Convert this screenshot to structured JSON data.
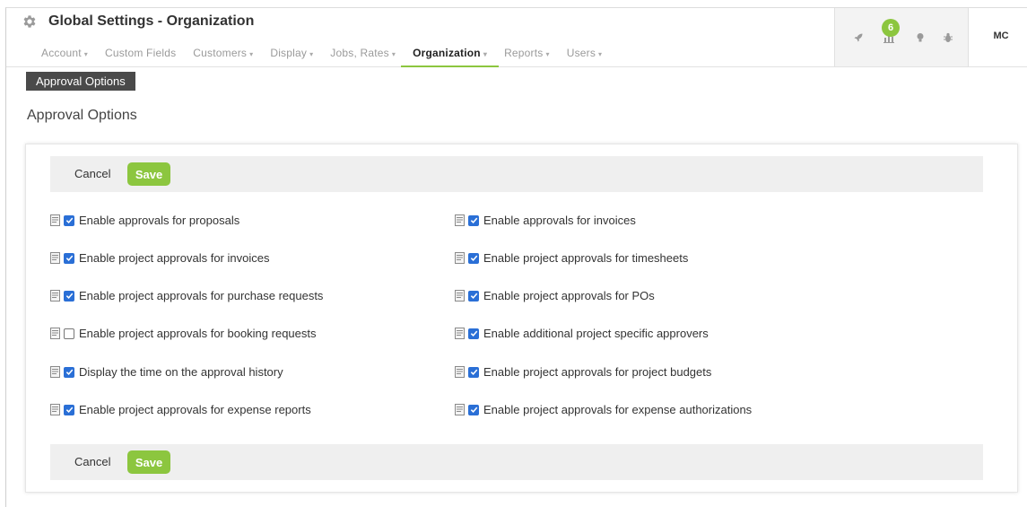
{
  "header": {
    "title": "Global Settings - Organization",
    "icon": "gear-icon",
    "nav": [
      {
        "label": "Account",
        "dropdown": true
      },
      {
        "label": "Custom Fields",
        "dropdown": false
      },
      {
        "label": "Customers",
        "dropdown": true
      },
      {
        "label": "Display",
        "dropdown": true
      },
      {
        "label": "Jobs, Rates",
        "dropdown": true
      },
      {
        "label": "Organization",
        "dropdown": true,
        "active": true
      },
      {
        "label": "Reports",
        "dropdown": true
      },
      {
        "label": "Users",
        "dropdown": true
      }
    ],
    "caret": "▾"
  },
  "toolbar_icons": {
    "icons": [
      "rocket-icon",
      "chart-icon",
      "lightbulb-icon",
      "bug-icon"
    ],
    "badge": "6",
    "avatar": "MC"
  },
  "breadcrumb": {
    "label": "Approval Options"
  },
  "page": {
    "title": "Approval Options"
  },
  "actions": {
    "cancel": "Cancel",
    "save": "Save"
  },
  "options": {
    "left": [
      {
        "label": "Enable approvals for proposals",
        "checked": true
      },
      {
        "label": "Enable project approvals for invoices",
        "checked": true
      },
      {
        "label": "Enable project approvals for purchase requests",
        "checked": true
      },
      {
        "label": "Enable project approvals for booking requests",
        "checked": false
      },
      {
        "label": "Display the time on the approval history",
        "checked": true
      },
      {
        "label": "Enable project approvals for expense reports",
        "checked": true
      }
    ],
    "right": [
      {
        "label": "Enable approvals for invoices",
        "checked": true
      },
      {
        "label": "Enable project approvals for timesheets",
        "checked": true
      },
      {
        "label": "Enable project approvals for POs",
        "checked": true
      },
      {
        "label": "Enable additional project specific approvers",
        "checked": true
      },
      {
        "label": "Enable project approvals for project budgets",
        "checked": true
      },
      {
        "label": "Enable project approvals for expense authorizations",
        "checked": true
      }
    ]
  },
  "colors": {
    "accent": "#8cc63f",
    "checkbox": "#2a6fd6",
    "tab_dark": "#4a4a4a"
  }
}
